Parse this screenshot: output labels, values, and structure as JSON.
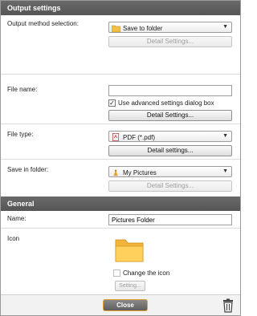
{
  "output_settings": {
    "header": "Output settings",
    "output_method": {
      "label": "Output method selection:",
      "selected": "Save to folder",
      "detail_button": "Detail Settings..."
    },
    "file_name": {
      "label": "File name:",
      "value": "",
      "advanced_checkbox_label": "Use advanced settings dialog box",
      "advanced_checked": true,
      "detail_button": "Detail Settings..."
    },
    "file_type": {
      "label": "File type:",
      "selected": "PDF (*.pdf)",
      "detail_button": "Detail settings..."
    },
    "save_in_folder": {
      "label": "Save in folder:",
      "selected": "My Pictures",
      "detail_button": "Detail Settings..."
    }
  },
  "general": {
    "header": "General",
    "name_label": "Name:",
    "name_value": "Pictures Folder",
    "icon_label": "Icon",
    "change_icon_label": "Change the icon",
    "change_icon_checked": false,
    "setting_button": "Setting..."
  },
  "footer": {
    "close_label": "Close"
  },
  "icons": {
    "folder": "folder-icon",
    "pdf": "pdf-icon",
    "pictures": "pictures-folder-icon",
    "trash": "trash-icon"
  },
  "colors": {
    "header_bg": "#5e5e5e",
    "close_border": "#e0a030"
  }
}
